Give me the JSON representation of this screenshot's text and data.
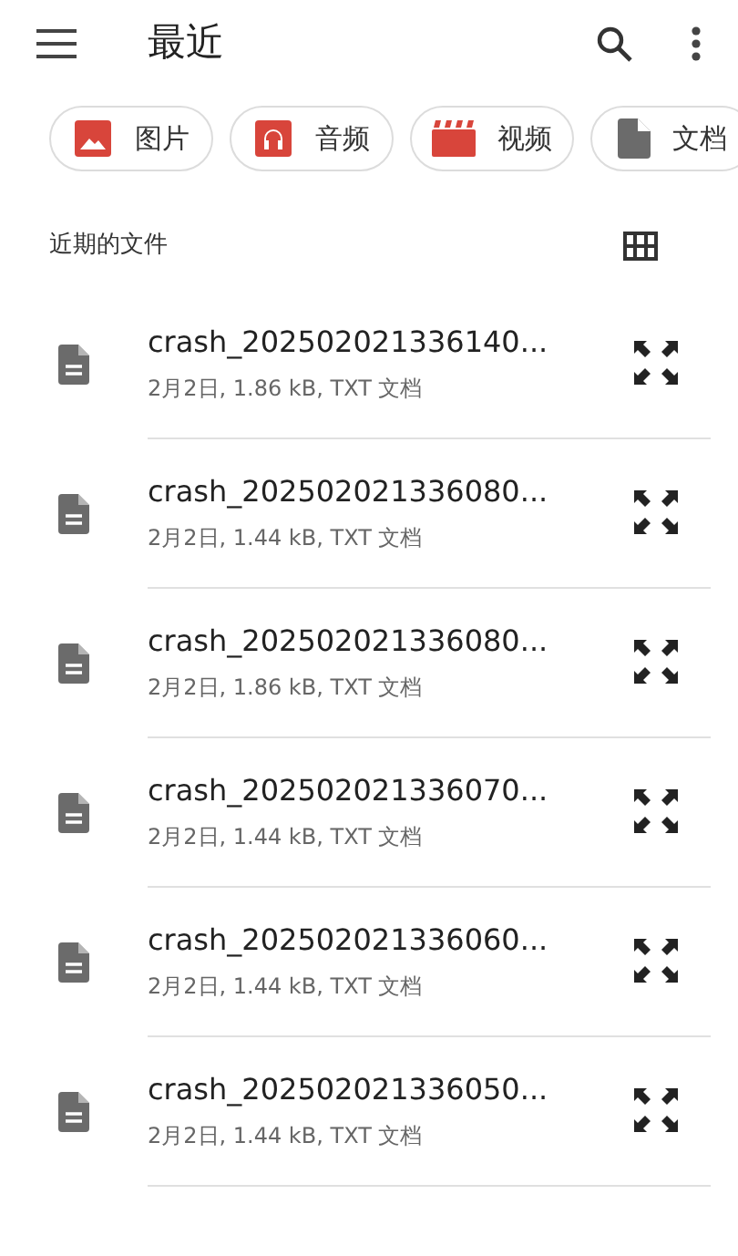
{
  "app_bar": {
    "title": "最近"
  },
  "chips": [
    {
      "kind": "image",
      "label": "图片"
    },
    {
      "kind": "audio",
      "label": "音频"
    },
    {
      "kind": "video",
      "label": "视频"
    },
    {
      "kind": "document",
      "label": "文档"
    }
  ],
  "section": {
    "title": "近期的文件"
  },
  "files": [
    {
      "name": "crash_202502021336140...",
      "meta": "2月2日, 1.86 kB, TXT 文档"
    },
    {
      "name": "crash_202502021336080...",
      "meta": "2月2日, 1.44 kB, TXT 文档"
    },
    {
      "name": "crash_202502021336080...",
      "meta": "2月2日, 1.86 kB, TXT 文档"
    },
    {
      "name": "crash_202502021336070...",
      "meta": "2月2日, 1.44 kB, TXT 文档"
    },
    {
      "name": "crash_202502021336060...",
      "meta": "2月2日, 1.44 kB, TXT 文档"
    },
    {
      "name": "crash_202502021336050...",
      "meta": "2月2日, 1.44 kB, TXT 文档"
    }
  ]
}
